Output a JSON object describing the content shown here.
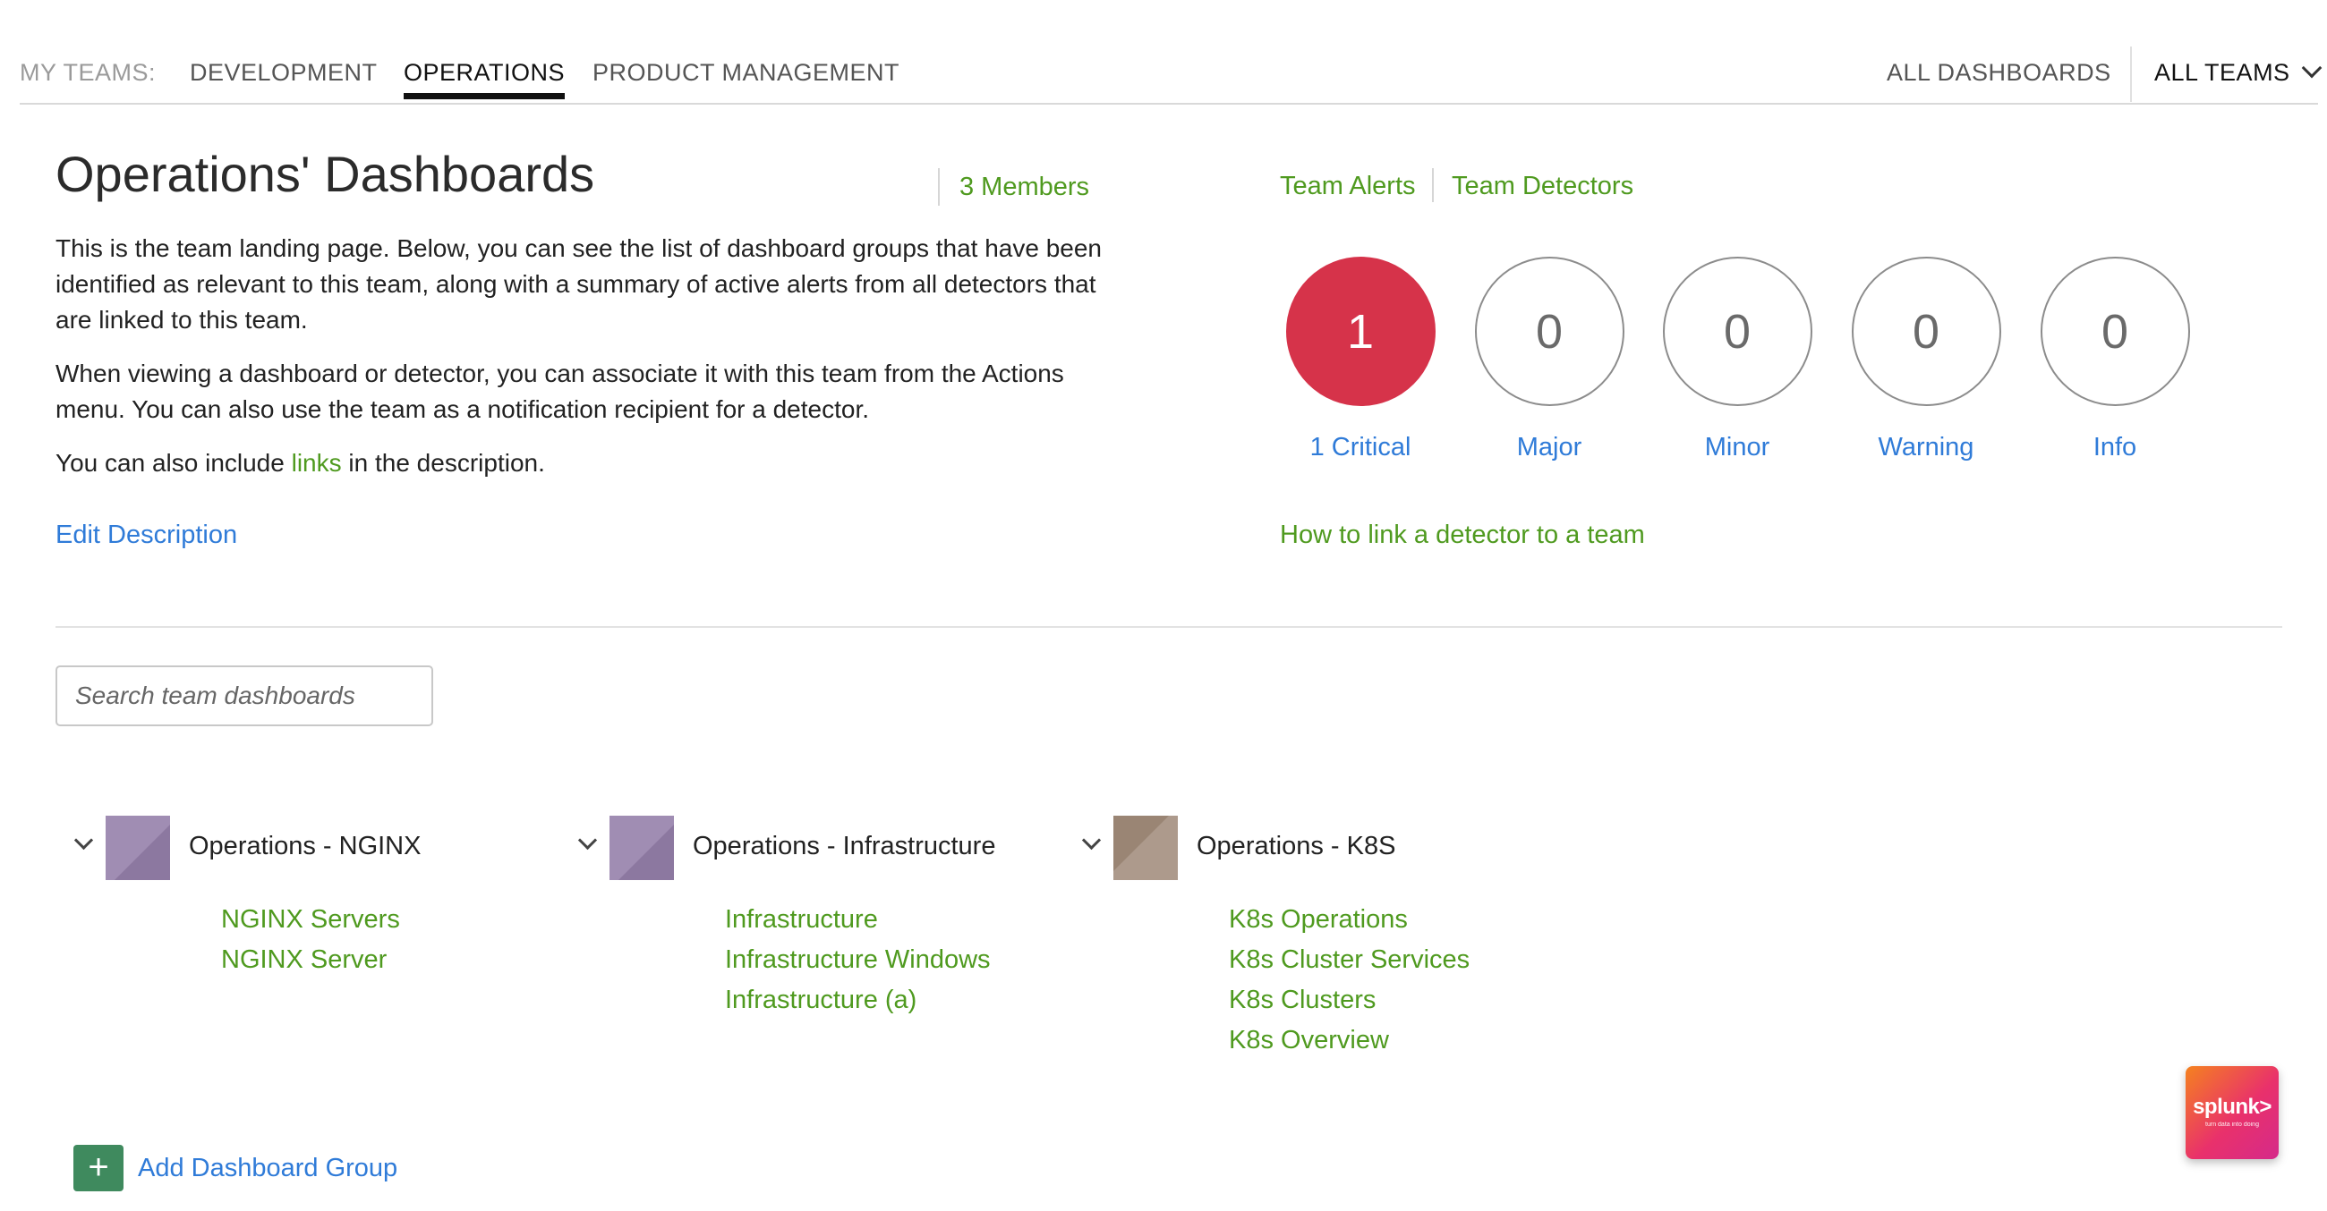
{
  "nav": {
    "label": "MY TEAMS:",
    "tabs": [
      "DEVELOPMENT",
      "OPERATIONS",
      "PRODUCT MANAGEMENT"
    ],
    "active_tab": "OPERATIONS",
    "all_dashboards": "ALL DASHBOARDS",
    "all_teams": "ALL TEAMS"
  },
  "header": {
    "title": "Operations' Dashboards",
    "members": "3 Members"
  },
  "description": {
    "p1": "This is the team landing page. Below, you can see the list of dashboard groups that have been identified as relevant to this team, along with a summary of active alerts from all detectors that are linked to this team.",
    "p2": "When viewing a dashboard or detector, you can associate it with this team from the Actions menu. You can also use the team as a notification recipient for a detector.",
    "p3_before": "You can also include ",
    "p3_link": "links",
    "p3_after": " in the description.",
    "edit": "Edit Description"
  },
  "alerts": {
    "team_alerts": "Team Alerts",
    "team_detectors": "Team Detectors",
    "severities": [
      {
        "count": "1",
        "label": "1 Critical"
      },
      {
        "count": "0",
        "label": "Major"
      },
      {
        "count": "0",
        "label": "Minor"
      },
      {
        "count": "0",
        "label": "Warning"
      },
      {
        "count": "0",
        "label": "Info"
      }
    ],
    "critical_color": "#d6334a",
    "how_to": "How to link a detector to a team"
  },
  "search": {
    "placeholder": "Search team dashboards"
  },
  "groups": [
    {
      "name": "Operations - NGINX",
      "thumb_color": "#9d8ab0",
      "dashboards": [
        "NGINX Servers",
        "NGINX Server"
      ]
    },
    {
      "name": "Operations - Infrastructure",
      "thumb_color": "#9d8ab0",
      "dashboards": [
        "Infrastructure",
        "Infrastructure Windows",
        "Infrastructure (a)"
      ]
    },
    {
      "name": "Operations - K8S",
      "thumb_color": "#a8968a",
      "dashboards": [
        "K8s Operations",
        "K8s Cluster Services",
        "K8s Clusters",
        "K8s Overview"
      ]
    }
  ],
  "add_group": "Add Dashboard Group",
  "logo": {
    "text": "splunk>",
    "tagline": "turn data into doing"
  }
}
